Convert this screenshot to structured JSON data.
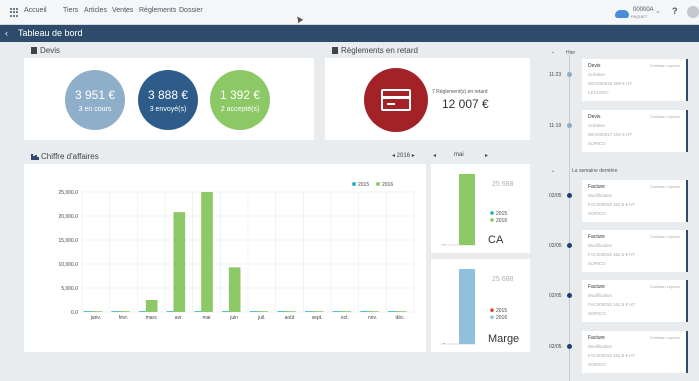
{
  "nav": {
    "home": "Accueil",
    "items": [
      "Tiers",
      "Articles",
      "Ventes",
      "Règlements",
      "Dossier"
    ]
  },
  "user": {
    "code": "00000A",
    "name": "PAQUET"
  },
  "header": {
    "title": "Tableau de bord",
    "help": "?"
  },
  "devis": {
    "title": "Devis",
    "stats": [
      {
        "amount": "3 951 €",
        "label": "3 en cours",
        "color": "#8faec9"
      },
      {
        "amount": "3 888 €",
        "label": "3 envoyé(s)",
        "color": "#2e5c8a"
      },
      {
        "amount": "1 392 €",
        "label": "2 accepté(s)",
        "color": "#8cc866"
      }
    ]
  },
  "reglements": {
    "title": "Règlements en retard",
    "caption": "7 Règlement(s) en retard",
    "amount": "12 007 €"
  },
  "ca": {
    "title": "Chiffre d'affaires",
    "year_control": "◂ 2016 ▸",
    "month_prev": "◂",
    "month": "mai",
    "month_next": "▸"
  },
  "chart_data": [
    {
      "type": "bar",
      "categories": [
        "janv.",
        "févr.",
        "mars",
        "avr.",
        "mai",
        "juin",
        "juil.",
        "août",
        "sept.",
        "oct.",
        "nov.",
        "déc."
      ],
      "series": [
        {
          "name": "2015",
          "color": "#2bb0c4",
          "values": [
            0,
            0,
            0,
            0,
            0,
            0,
            0,
            0,
            0,
            0,
            0,
            0
          ]
        },
        {
          "name": "2016",
          "color": "#8cc866",
          "values": [
            0,
            0,
            2500,
            20800,
            25000,
            9300,
            0,
            0,
            0,
            0,
            0,
            0
          ]
        }
      ],
      "yticks": [
        "0.0",
        "5,000.0",
        "10,000.0",
        "15,000.0",
        "20,000.0",
        "25,000.0"
      ],
      "ylim": [
        0,
        25000
      ],
      "grid": true,
      "legend": "top-right"
    },
    {
      "type": "bar",
      "label": "CA",
      "value_label": "25 688",
      "series": [
        {
          "name": "2015",
          "color": "#2bb0c4",
          "values": [
            0
          ]
        },
        {
          "name": "2016",
          "color": "#8cc866",
          "values": [
            25688
          ]
        }
      ]
    },
    {
      "type": "bar",
      "label": "Marge",
      "value_label": "25 688",
      "series": [
        {
          "name": "2015",
          "color": "#d6432f",
          "values": [
            0
          ]
        },
        {
          "name": "2016",
          "color": "#8fc1dd",
          "values": [
            25688
          ]
        }
      ]
    }
  ],
  "timeline": {
    "group1": "Hier",
    "group2": "La semaine dernière",
    "events": [
      {
        "time": "11:23",
        "type": "Devis",
        "author": "Christian Leprion",
        "action": "Création",
        "ref": "DEV000018 999 € HT",
        "client": "LECLERC",
        "dot": "#8faec9"
      },
      {
        "time": "11:19",
        "type": "Devis",
        "author": "Christian Leprion",
        "action": "Création",
        "ref": "DEV000017 152 € HT",
        "client": "SORICO",
        "dot": "#8faec9"
      },
      {
        "time": "02/05",
        "type": "Facture",
        "author": "Christian Leprion",
        "action": "Modification",
        "ref": "FAC000018 162,5 € HT",
        "client": "SORICO",
        "dot": "#1f3f6e"
      },
      {
        "time": "02/05",
        "type": "Facture",
        "author": "Christian Leprion",
        "action": "Modification",
        "ref": "FAC000018 162,5 € HT",
        "client": "SORICO",
        "dot": "#1f3f6e"
      },
      {
        "time": "02/05",
        "type": "Facture",
        "author": "Christian Leprion",
        "action": "Modification",
        "ref": "FAC000018 162,5 € HT",
        "client": "SORICO",
        "dot": "#1f3f6e"
      },
      {
        "time": "02/05",
        "type": "Facture",
        "author": "Christian Leprion",
        "action": "Modification",
        "ref": "FAC000018 162,5 € HT",
        "client": "SORICO",
        "dot": "#1f3f6e"
      }
    ]
  }
}
